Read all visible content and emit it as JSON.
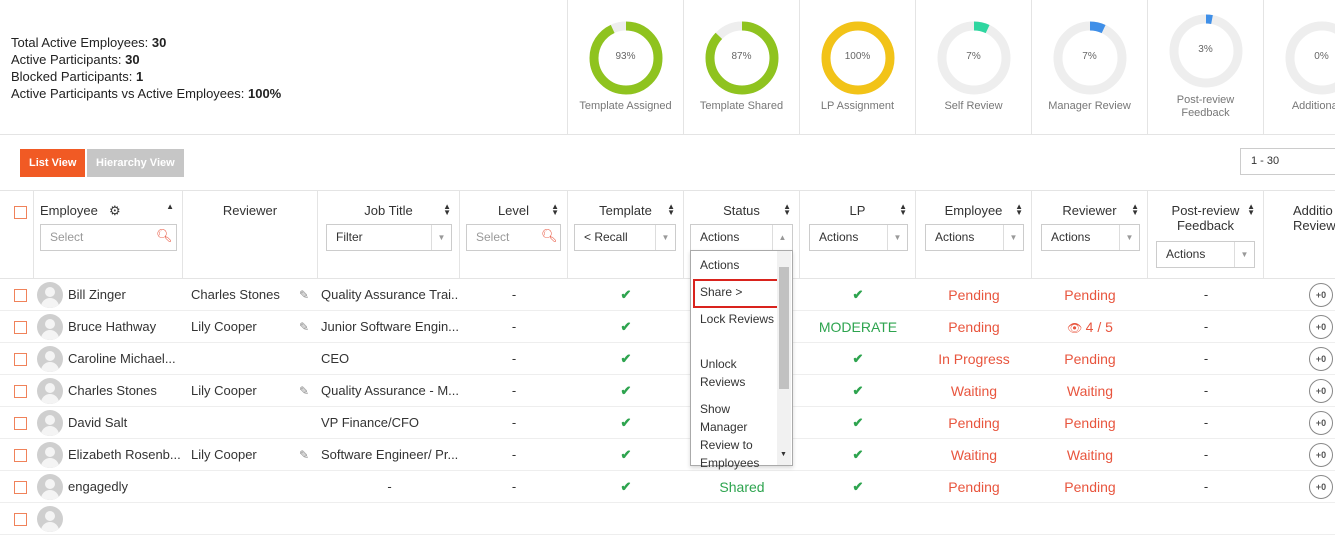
{
  "stats": {
    "total_active_label": "Total Active Employees: ",
    "total_active_value": "30",
    "active_participants_label": "Active Participants: ",
    "active_participants_value": "30",
    "blocked_label": "Blocked Participants: ",
    "blocked_value": "1",
    "ratio_label": "Active Participants vs Active Employees: ",
    "ratio_value": "100%"
  },
  "donuts": [
    {
      "pct": "93%",
      "value": 0.93,
      "label": "Template Assigned",
      "color": "#8fc31f"
    },
    {
      "pct": "87%",
      "value": 0.87,
      "label": "Template Shared",
      "color": "#8fc31f"
    },
    {
      "pct": "100%",
      "value": 1.0,
      "label": "LP Assignment",
      "color": "#f2c318"
    },
    {
      "pct": "7%",
      "value": 0.07,
      "label": "Self Review",
      "color": "#2fd6a0"
    },
    {
      "pct": "7%",
      "value": 0.07,
      "label": "Manager Review",
      "color": "#3f8fe8"
    },
    {
      "pct": "3%",
      "value": 0.03,
      "label": "Post-review Feedback",
      "color": "#3f8fe8"
    },
    {
      "pct": "0%",
      "value": 0,
      "label": "Additional R",
      "color": "#cccccc"
    }
  ],
  "views": {
    "list": "List View",
    "hierarchy": "Hierarchy View"
  },
  "pager": "1 - 30",
  "columns": {
    "employee": "Employee",
    "reviewer": "Reviewer",
    "job_title": "Job Title",
    "level": "Level",
    "template": "Template",
    "status": "Status",
    "lp": "LP",
    "employee2": "Employee",
    "reviewer2": "Reviewer",
    "post_review": "Post-review Feedback",
    "additional": "Additio Review"
  },
  "filters": {
    "employee_placeholder": "Select",
    "job_title": "Filter",
    "level_placeholder": "Select",
    "template": "< Recall",
    "status": "Actions",
    "lp": "Actions",
    "employee2": "Actions",
    "reviewer2": "Actions",
    "post_review": "Actions"
  },
  "status_dropdown": {
    "items": [
      "Actions",
      "Share >",
      "Lock Reviews",
      "Unlock Reviews",
      "Show Manager Review to Employees"
    ],
    "highlight_color": "#d9231d"
  },
  "rows": [
    {
      "name": "Bill Zinger",
      "reviewer": "Charles Stones",
      "job": "Quality Assurance Trai...",
      "level": "-",
      "template": "✔",
      "status": "",
      "lp": "✔",
      "employee": "Pending",
      "reviewer_status": "Pending",
      "post": "-",
      "additional": "+0"
    },
    {
      "name": "Bruce Hathway",
      "reviewer": "Lily Cooper",
      "job": "Junior Software Engin...",
      "level": "-",
      "template": "✔",
      "status": "",
      "lp": "MODERATE",
      "employee": "Pending",
      "reviewer_status": "4 / 5",
      "post": "-",
      "additional": "+0"
    },
    {
      "name": "Caroline Michael...",
      "reviewer": "",
      "job": "CEO",
      "level": "-",
      "template": "✔",
      "status": "",
      "lp": "✔",
      "employee": "In Progress",
      "reviewer_status": "Pending",
      "post": "-",
      "additional": "+0"
    },
    {
      "name": "Charles Stones",
      "reviewer": "Lily Cooper",
      "job": "Quality Assurance - M...",
      "level": "-",
      "template": "✔",
      "status": "",
      "lp": "✔",
      "employee": "Waiting",
      "reviewer_status": "Waiting",
      "post": "-",
      "additional": "+0"
    },
    {
      "name": "David Salt",
      "reviewer": "",
      "job": "VP Finance/CFO",
      "level": "-",
      "template": "✔",
      "status": "",
      "lp": "✔",
      "employee": "Pending",
      "reviewer_status": "Pending",
      "post": "-",
      "additional": "+0"
    },
    {
      "name": "Elizabeth Rosenb...",
      "reviewer": "Lily Cooper",
      "job": "Software Engineer/ Pr...",
      "level": "-",
      "template": "✔",
      "status": "",
      "lp": "✔",
      "employee": "Waiting",
      "reviewer_status": "Waiting",
      "post": "-",
      "additional": "+0"
    },
    {
      "name": "engagedly",
      "reviewer": "",
      "job": "-",
      "level": "-",
      "template": "✔",
      "status": "Shared",
      "lp": "✔",
      "employee": "Pending",
      "reviewer_status": "Pending",
      "post": "-",
      "additional": "+0"
    }
  ]
}
